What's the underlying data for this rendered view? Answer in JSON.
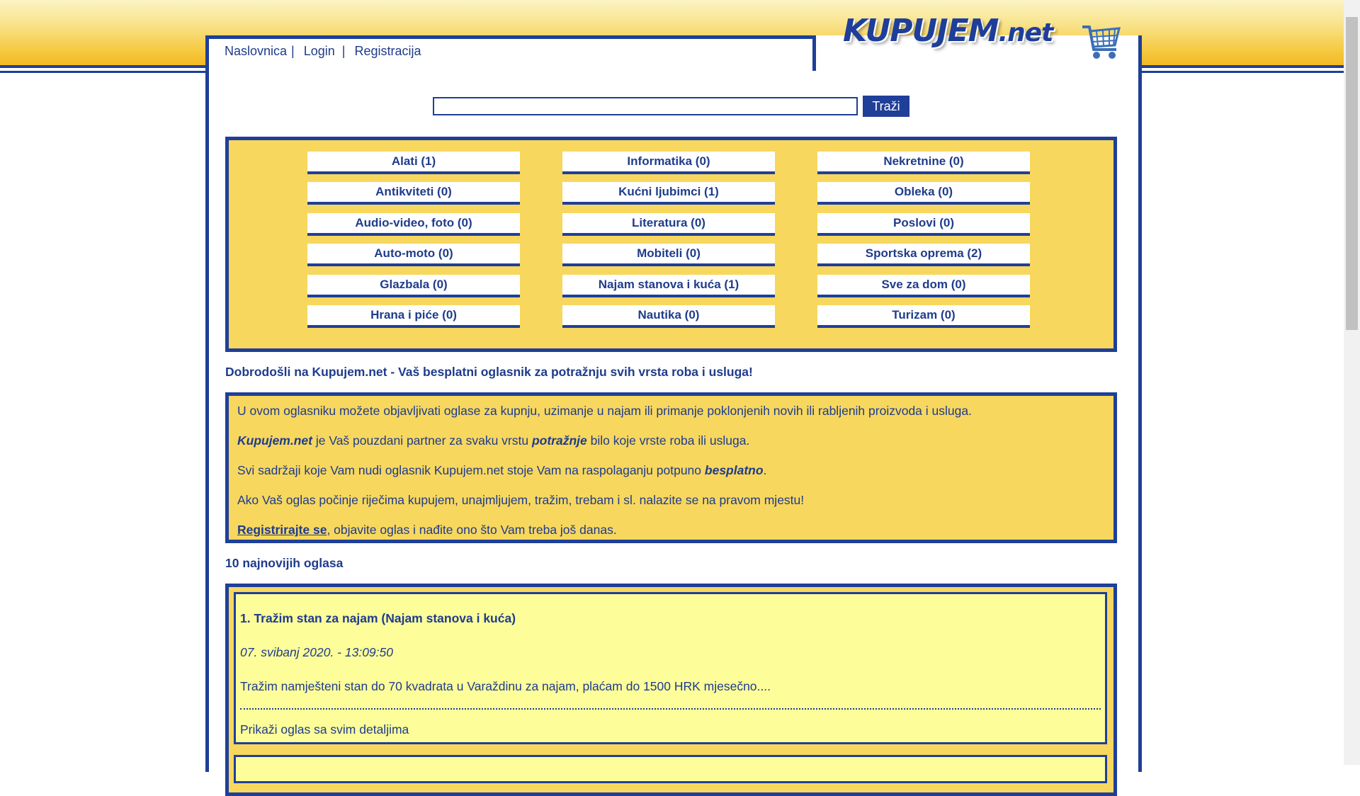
{
  "header": {
    "logo_main": "KUPUJEM",
    "logo_suffix": ".net"
  },
  "nav": {
    "home": "Naslovnica",
    "sep1": "|",
    "login": "Login",
    "sep2": "|",
    "register": "Registracija"
  },
  "search": {
    "value": "",
    "button": "Traži"
  },
  "categories": [
    "Alati (1)",
    "Informatika (0)",
    "Nekretnine (0)",
    "Antikviteti (0)",
    "Kućni ljubimci (1)",
    "Obleka (0)",
    "Audio-video, foto (0)",
    "Literatura (0)",
    "Poslovi (0)",
    "Auto-moto (0)",
    "Mobiteli (0)",
    "Sportska oprema (2)",
    "Glazbala (0)",
    "Najam stanova i kuća (1)",
    "Sve za dom (0)",
    "Hrana i piće (0)",
    "Nautika (0)",
    "Turizam (0)"
  ],
  "welcome": "Dobrodošli na Kupujem.net - Vaš besplatni oglasnik za potražnju svih vrsta roba i usluga!",
  "info": {
    "p1": "U ovom oglasniku možete objavljivati oglase za kupnju, uzimanje u najam ili primanje poklonjenih novih ili rabljenih proizvoda i usluga.",
    "p2_brand": "Kupujem.net",
    "p2_text1": " je Vaš pouzdani partner za svaku vrstu ",
    "p2_em": "potražnje",
    "p2_text2": " bilo koje vrste roba ili usluga.",
    "p3_text": "Svi sadržaji koje Vam nudi oglasnik Kupujem.net stoje Vam na raspolaganju potpuno ",
    "p3_em": "besplatno",
    "p3_end": ".",
    "p4": "Ako Vaš oglas počinje riječima kupujem, unajmljujem, tražim, trebam i sl. nalazite se na pravom mjestu!",
    "p5_link": "Registrirajte se",
    "p5_text": ", objavite oglas i nađite ono što Vam treba još danas."
  },
  "newest_title": "10 najnovijih oglasa",
  "ads": [
    {
      "title": "1. Tražim stan za najam (Najam stanova i kuća)",
      "date": "07. svibanj 2020. - 13:09:50",
      "desc": "Tražim namješteni stan do 70 kvadrata u Varaždinu za najam, plaćam do 1500 HRK mjesečno....",
      "link": "Prikaži oglas sa svim detaljima"
    }
  ],
  "colors": {
    "brand_blue": "#1f3f98",
    "panel_yellow": "#f7d75e",
    "card_yellow": "#fdfd9a"
  }
}
